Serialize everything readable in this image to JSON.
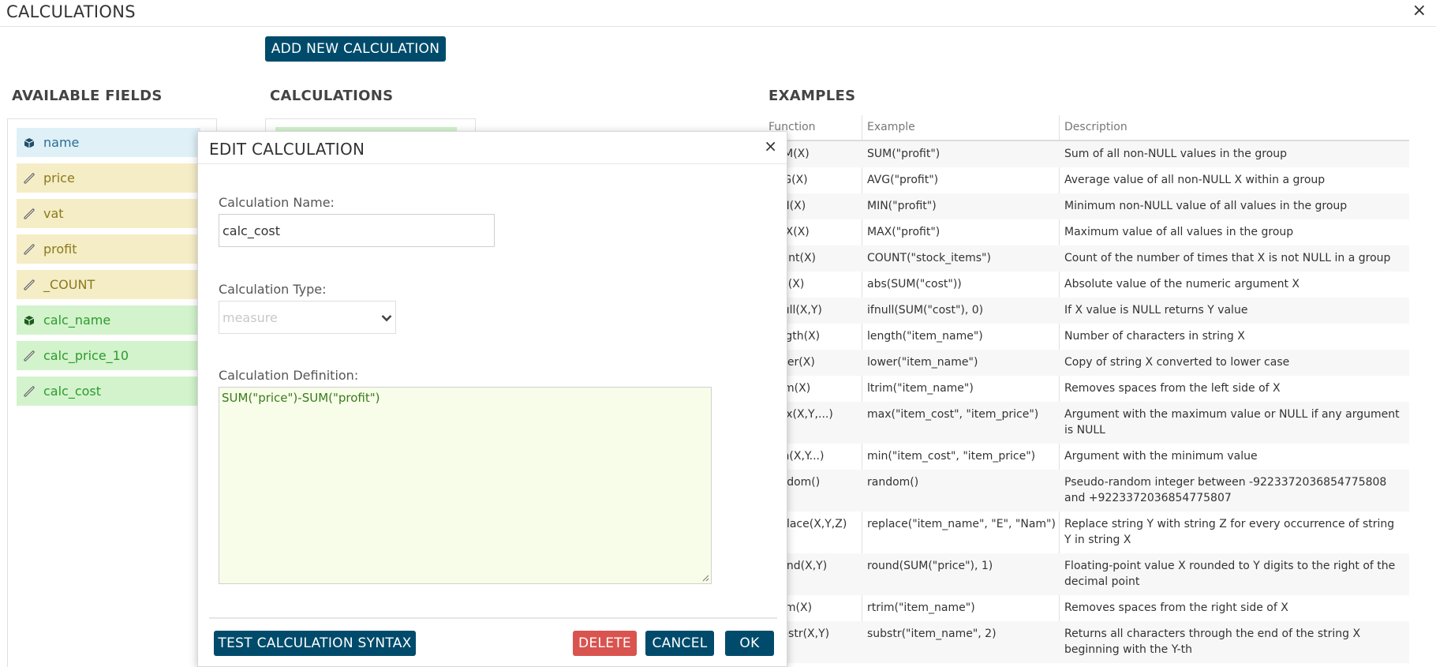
{
  "header": {
    "title": "CALCULATIONS",
    "close_icon": "×"
  },
  "toolbar": {
    "add_label": "ADD NEW CALCULATION"
  },
  "sections": {
    "fields_title": "AVAILABLE FIELDS",
    "calcs_title": "CALCULATIONS",
    "examples_title": "EXAMPLES"
  },
  "fields": [
    {
      "label": "name",
      "kind": "dimension",
      "icon": "cube-icon"
    },
    {
      "label": "price",
      "kind": "measure",
      "icon": "ruler-icon"
    },
    {
      "label": "vat",
      "kind": "measure",
      "icon": "ruler-icon"
    },
    {
      "label": "profit",
      "kind": "measure",
      "icon": "ruler-icon"
    },
    {
      "label": "_COUNT",
      "kind": "measure",
      "icon": "ruler-icon"
    },
    {
      "label": "calc_name",
      "kind": "calc-dimension",
      "icon": "cube-icon"
    },
    {
      "label": "calc_price_10",
      "kind": "calc-measure",
      "icon": "ruler-icon"
    },
    {
      "label": "calc_cost",
      "kind": "calc-measure",
      "icon": "ruler-icon"
    }
  ],
  "examples": {
    "headers": [
      "Function",
      "Example",
      "Description"
    ],
    "rows": [
      [
        "SUM(X)",
        "SUM(\"profit\")",
        "Sum of all non-NULL values in the group"
      ],
      [
        "AVG(X)",
        "AVG(\"profit\")",
        "Average value of all non-NULL X within a group"
      ],
      [
        "MIN(X)",
        "MIN(\"profit\")",
        "Minimum non-NULL value of all values in the group"
      ],
      [
        "MAX(X)",
        "MAX(\"profit\")",
        "Maximum value of all values in the group"
      ],
      [
        "count(X)",
        "COUNT(\"stock_items\")",
        "Count of the number of times that X is not NULL in a group"
      ],
      [
        "abs(X)",
        "abs(SUM(\"cost\"))",
        "Absolute value of the numeric argument X"
      ],
      [
        "ifnull(X,Y)",
        "ifnull(SUM(\"cost\"), 0)",
        "If X value is NULL returns Y value"
      ],
      [
        "length(X)",
        "length(\"item_name\")",
        "Number of characters in string X"
      ],
      [
        "lower(X)",
        "lower(\"item_name\")",
        "Copy of string X converted to lower case"
      ],
      [
        "ltrim(X)",
        "ltrim(\"item_name\")",
        "Removes spaces from the left side of X"
      ],
      [
        "max(X,Y,...)",
        "max(\"item_cost\", \"item_price\")",
        "Argument with the maximum value or NULL if any argument is NULL"
      ],
      [
        "min(X,Y...)",
        "min(\"item_cost\", \"item_price\")",
        "Argument with the minimum value"
      ],
      [
        "random()",
        "random()",
        "Pseudo-random integer between -9223372036854775808 and +9223372036854775807"
      ],
      [
        "replace(X,Y,Z)",
        "replace(\"item_name\", \"E\", \"Nam\")",
        "Replace string Y with string Z for every occurrence of string Y in string X"
      ],
      [
        "round(X,Y)",
        "round(SUM(\"price\"), 1)",
        "Floating-point value X rounded to Y digits to the right of the decimal point"
      ],
      [
        "rtrim(X)",
        "rtrim(\"item_name\")",
        "Removes spaces from the right side of X"
      ],
      [
        "substr(X,Y)",
        "substr(\"item_name\", 2)",
        "Returns all characters through the end of the string X beginning with the Y-th"
      ]
    ]
  },
  "modal": {
    "title": "EDIT CALCULATION",
    "close_icon": "×",
    "name_label": "Calculation Name:",
    "name_value": "calc_cost",
    "type_label": "Calculation Type:",
    "type_value": "measure",
    "definition_label": "Calculation Definition:",
    "definition_value": "SUM(\"price\")-SUM(\"profit\")",
    "test_label": "TEST CALCULATION SYNTAX",
    "delete_label": "DELETE",
    "cancel_label": "CANCEL",
    "ok_label": "OK"
  },
  "colors": {
    "primary": "#004b6b",
    "danger": "#d9534f",
    "dimension_bg": "#dff0f7",
    "measure_bg": "#f5edc6",
    "calc_bg": "#d2f3cc",
    "definition_bg": "#f7fde8"
  }
}
